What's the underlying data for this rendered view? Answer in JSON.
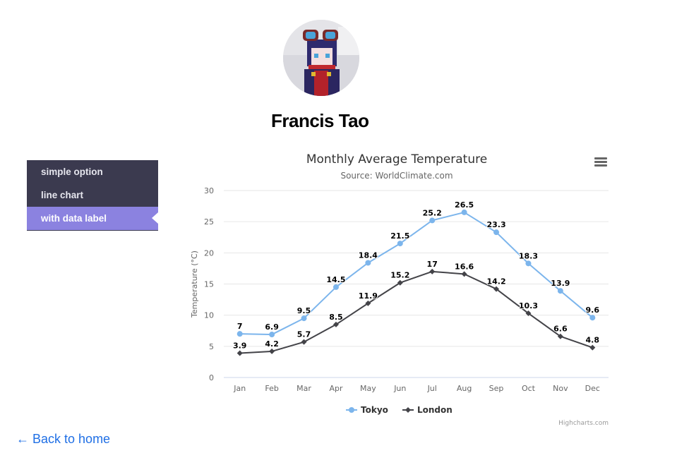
{
  "profile": {
    "name": "Francis Tao"
  },
  "sidebar": {
    "items": [
      {
        "label": "simple option",
        "active": false
      },
      {
        "label": "line chart",
        "active": false
      },
      {
        "label": "with data label",
        "active": true
      }
    ]
  },
  "back_link": {
    "arrow": "←",
    "label": "Back to home"
  },
  "chart_data": {
    "type": "line",
    "title": "Monthly Average Temperature",
    "subtitle": "Source: WorldClimate.com",
    "xlabel": "",
    "ylabel": "Temperature (°C)",
    "categories": [
      "Jan",
      "Feb",
      "Mar",
      "Apr",
      "May",
      "Jun",
      "Jul",
      "Aug",
      "Sep",
      "Oct",
      "Nov",
      "Dec"
    ],
    "ylim": [
      0,
      30
    ],
    "yticks": [
      0,
      5,
      10,
      15,
      20,
      25,
      30
    ],
    "grid": true,
    "data_labels": true,
    "legend_position": "bottom-center",
    "series": [
      {
        "name": "Tokyo",
        "color": "#7cb5ec",
        "marker": "circle",
        "values": [
          7.0,
          6.9,
          9.5,
          14.5,
          18.4,
          21.5,
          25.2,
          26.5,
          23.3,
          18.3,
          13.9,
          9.6
        ]
      },
      {
        "name": "London",
        "color": "#434348",
        "marker": "diamond",
        "values": [
          3.9,
          4.2,
          5.7,
          8.5,
          11.9,
          15.2,
          17.0,
          16.6,
          14.2,
          10.3,
          6.6,
          4.8
        ]
      }
    ],
    "credits": "Highcharts.com",
    "menu_icon": "hamburger-menu-icon"
  }
}
